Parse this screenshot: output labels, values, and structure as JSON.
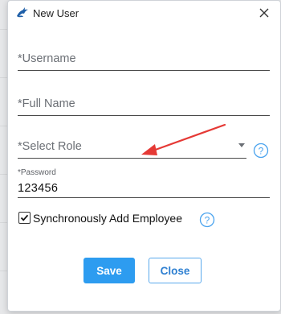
{
  "dialog": {
    "title": "New User",
    "fields": {
      "username_placeholder": "*Username",
      "fullname_placeholder": "*Full Name",
      "role_placeholder": "*Select Role",
      "password_label": "*Password",
      "password_value": "123456"
    },
    "checkbox": {
      "label": "Synchronously Add Employee",
      "checked": true
    },
    "buttons": {
      "save": "Save",
      "close": "Close"
    }
  },
  "colors": {
    "primary": "#2d9cf0",
    "help_icon": "#4aa3ee",
    "annotation_arrow": "#e53935"
  },
  "icons": {
    "logo": "bird-logo-icon",
    "close": "close-icon",
    "dropdown": "caret-down-icon",
    "help": "question-circle-icon"
  }
}
